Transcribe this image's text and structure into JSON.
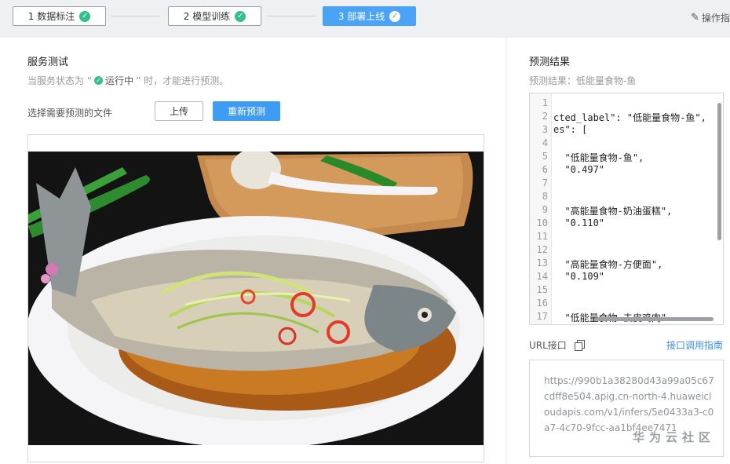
{
  "steps": [
    {
      "label": "1 数据标注"
    },
    {
      "label": "2 模型训练"
    },
    {
      "label": "3 部署上线"
    }
  ],
  "ops_label": "操作指",
  "service": {
    "title": "服务测试",
    "sub_prefix": "当服务状态为 “",
    "sub_status": "运行中",
    "sub_suffix": "” 时，才能进行预测。",
    "file_label": "选择需要预测的文件",
    "upload_btn": "上传",
    "repredict_btn": "重新预测"
  },
  "result": {
    "title": "预测结果",
    "summary": "预测结果：低能量食物-鱼",
    "line_numbers": [
      "1",
      "2",
      "3",
      "4",
      "5",
      "6",
      "7",
      "8",
      "9",
      "10",
      "11",
      "12",
      "13",
      "14",
      "15",
      "16",
      "17"
    ],
    "code_lines": [
      "",
      "cted_label\": \"低能量食物-鱼\",",
      "es\": [",
      "",
      "  \"低能量食物-鱼\",",
      "  \"0.497\"",
      "",
      "",
      "  \"高能量食物-奶油蛋糕\",",
      "  \"0.110\"",
      "",
      "",
      "  \"高能量食物-方便面\",",
      "  \"0.109\"",
      "",
      "",
      "  \"低能量食物-去皮鸡肉\""
    ]
  },
  "url": {
    "label": "URL接口",
    "guide": "接口调用指南",
    "value": "https://990b1a38280d43a99a05c67cdff8e504.apig.cn-north-4.huaweicloudapis.com/v1/infers/5e0433a3-c0a7-4c70-9fcc-aa1bf4ee7471"
  },
  "watermark": "华为云社区",
  "colors": {
    "accent": "#3e9cf5",
    "success": "#34c08b"
  }
}
